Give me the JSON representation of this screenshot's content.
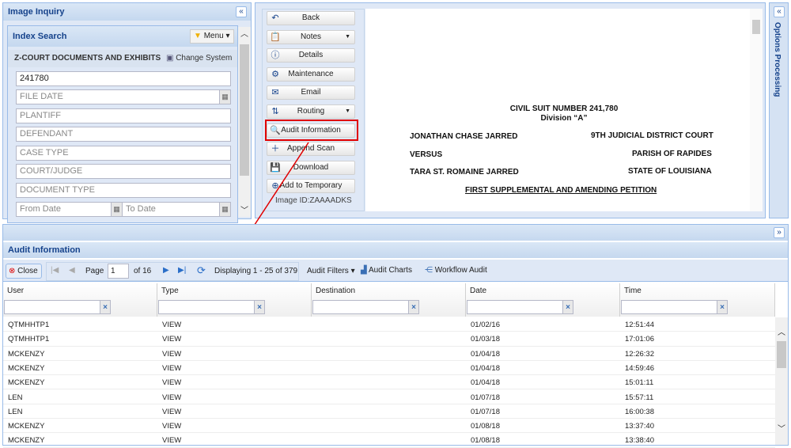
{
  "left": {
    "title": "Image Inquiry",
    "index_title": "Index Search",
    "menu": "Menu",
    "system": "Z-COURT DOCUMENTS AND EXHIBITS",
    "change_system": "Change System",
    "fields": [
      {
        "value": "241780"
      },
      {
        "placeholder": "FILE DATE"
      },
      {
        "placeholder": "PLANTIFF"
      },
      {
        "placeholder": "DEFENDANT"
      },
      {
        "placeholder": "CASE TYPE"
      },
      {
        "placeholder": "COURT/JUDGE"
      },
      {
        "placeholder": "DOCUMENT TYPE"
      }
    ],
    "from_date": "From Date",
    "to_date": "To Date"
  },
  "actions": [
    "Back",
    "Notes",
    "Details",
    "Maintenance",
    "Email",
    "Routing",
    "Audit Information",
    "Append Scan",
    "Download",
    "Add to Temporary"
  ],
  "image_id": "Image ID:ZAAAADKS",
  "document": {
    "line1": "CIVIL SUIT NUMBER 241,780",
    "line2": "Division “A”",
    "plaintiff": "JONATHAN CHASE JARRED",
    "court": "9TH JUDICIAL DISTRICT COURT",
    "versus": "VERSUS",
    "parish": "PARISH OF RAPIDES",
    "defendant": "TARA ST. ROMAINE JARRED",
    "state": "STATE OF LOUISIANA",
    "title": "FIRST SUPPLEMENTAL AND AMENDING PETITION"
  },
  "right": {
    "title": "Options Processing"
  },
  "audit": {
    "title": "Audit Information",
    "close": "Close",
    "page_label": "Page",
    "page": "1",
    "of": "of 16",
    "displaying": "Displaying 1 - 25 of 379",
    "filters": "Audit Filters",
    "charts": "Audit Charts",
    "workflow": "Workflow Audit",
    "columns": [
      "User",
      "Type",
      "Destination",
      "Date",
      "Time"
    ],
    "rows": [
      [
        "QTMHHTP1",
        "VIEW",
        "",
        "01/02/16",
        "12:51:44"
      ],
      [
        "QTMHHTP1",
        "VIEW",
        "",
        "01/03/18",
        "17:01:06"
      ],
      [
        "MCKENZY",
        "VIEW",
        "",
        "01/04/18",
        "12:26:32"
      ],
      [
        "MCKENZY",
        "VIEW",
        "",
        "01/04/18",
        "14:59:46"
      ],
      [
        "MCKENZY",
        "VIEW",
        "",
        "01/04/18",
        "15:01:11"
      ],
      [
        "LEN",
        "VIEW",
        "",
        "01/07/18",
        "15:57:11"
      ],
      [
        "LEN",
        "VIEW",
        "",
        "01/07/18",
        "16:00:38"
      ],
      [
        "MCKENZY",
        "VIEW",
        "",
        "01/08/18",
        "13:37:40"
      ],
      [
        "MCKENZY",
        "VIEW",
        "",
        "01/08/18",
        "13:38:40"
      ]
    ]
  },
  "colors": {
    "accent": "#15428b",
    "border": "#99bbe8",
    "highlight": "#e00000"
  }
}
